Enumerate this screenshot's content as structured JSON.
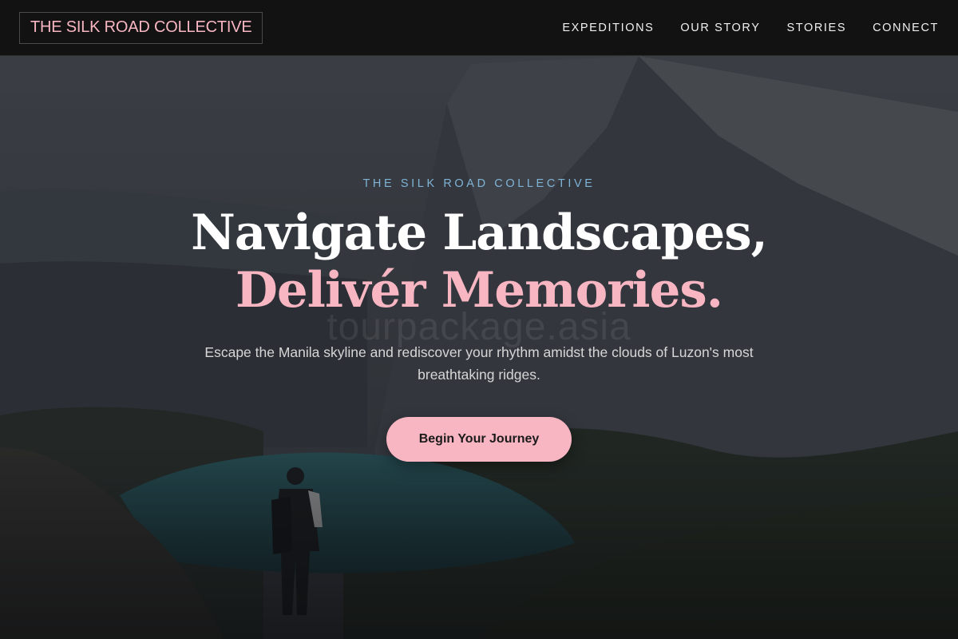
{
  "nav": {
    "brand": "THE SILK ROAD COLLECTIVE",
    "links": [
      "EXPEDITIONS",
      "OUR STORY",
      "STORIES",
      "CONNECT"
    ]
  },
  "hero": {
    "eyebrow": "THE SILK ROAD COLLECTIVE",
    "headline_line1": "Navigate Landscapes,",
    "headline_line2": "Delivér Memories.",
    "subtitle": "Escape the Manila skyline and rediscover your rhythm amidst the clouds of Luzon's most breathtaking ridges.",
    "cta_label": "Begin Your Journey",
    "watermark": "tourpackage.asia",
    "background": "mountain-lake-hiker-photo"
  },
  "colors": {
    "accent": "#f7b6c2",
    "eyebrow": "#7fb3d5",
    "nav_bg": "#111111"
  }
}
